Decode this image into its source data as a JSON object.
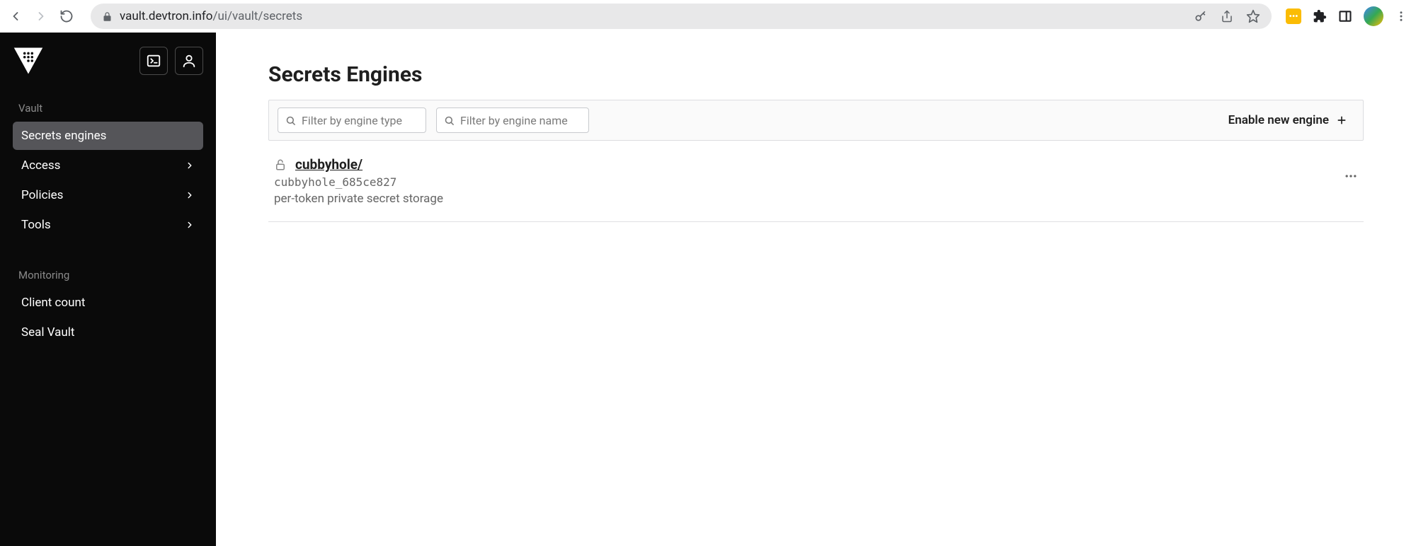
{
  "browser": {
    "url_host": "vault.devtron.info",
    "url_path": "/ui/vault/secrets"
  },
  "sidebar": {
    "sections": [
      {
        "label": "Vault",
        "items": [
          {
            "label": "Secrets engines",
            "active": true,
            "expandable": false
          },
          {
            "label": "Access",
            "active": false,
            "expandable": true
          },
          {
            "label": "Policies",
            "active": false,
            "expandable": true
          },
          {
            "label": "Tools",
            "active": false,
            "expandable": true
          }
        ]
      },
      {
        "label": "Monitoring",
        "items": [
          {
            "label": "Client count",
            "active": false,
            "expandable": false
          },
          {
            "label": "Seal Vault",
            "active": false,
            "expandable": false
          }
        ]
      }
    ]
  },
  "page": {
    "title": "Secrets Engines",
    "filters": {
      "type_placeholder": "Filter by engine type",
      "name_placeholder": "Filter by engine name"
    },
    "enable_new_label": "Enable new engine"
  },
  "engines": [
    {
      "name": "cubbyhole/",
      "id": "cubbyhole_685ce827",
      "description": "per-token private secret storage"
    }
  ]
}
